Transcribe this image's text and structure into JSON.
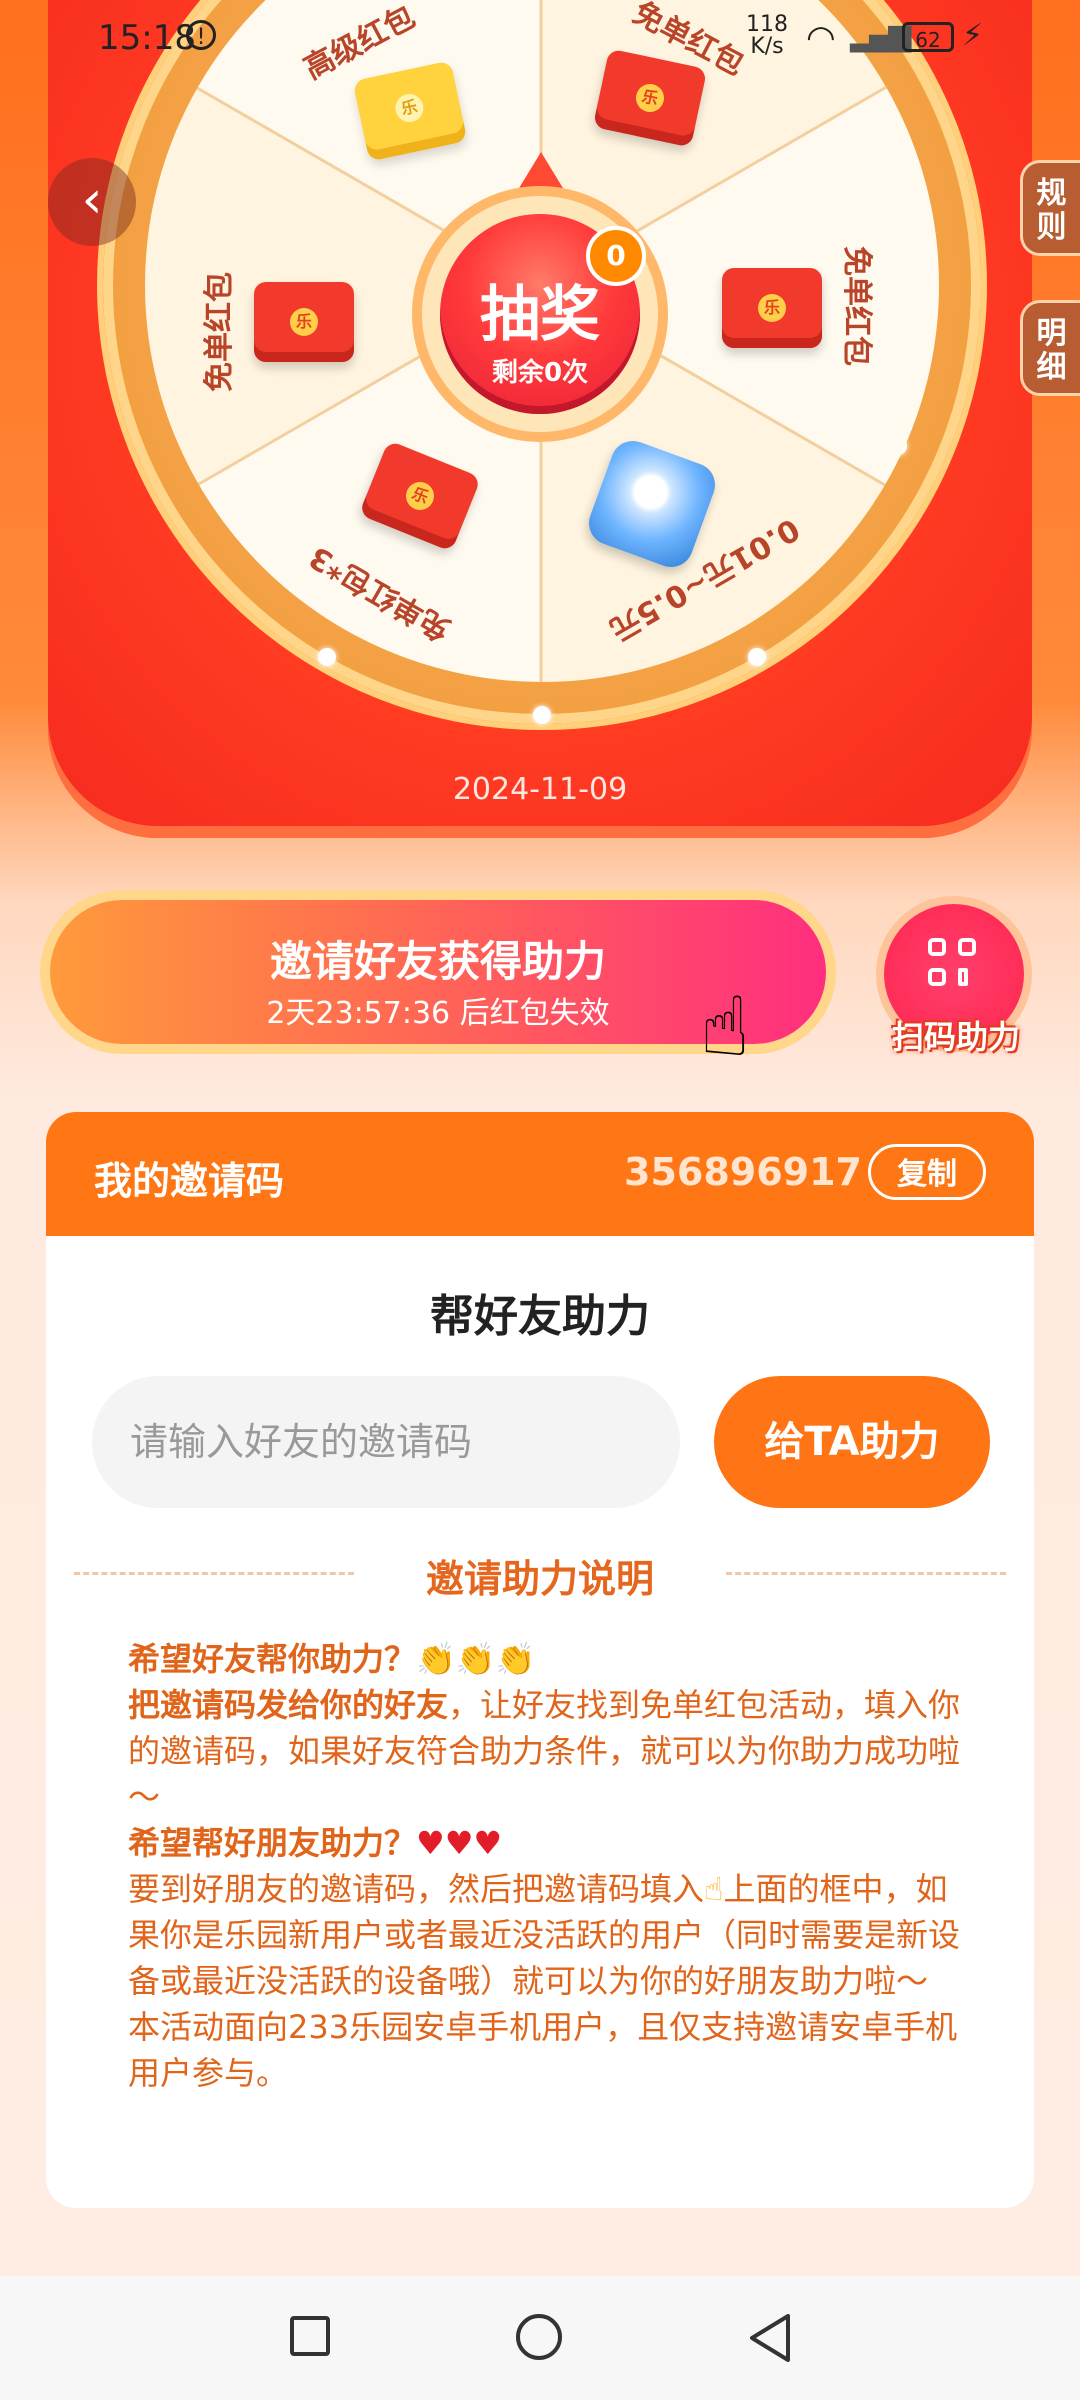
{
  "status_bar": {
    "time": "15:18",
    "alert_icon": "!",
    "net_speed": "118",
    "net_unit": "K/s",
    "battery": "62"
  },
  "wheel": {
    "prizes": [
      {
        "label": "高级红包",
        "icon": "yellow-envelope"
      },
      {
        "label": "免单红包",
        "icon": "red-envelope"
      },
      {
        "label": "免单红包",
        "icon": "red-envelope"
      },
      {
        "label": "0.01元~0.5元",
        "icon": "game-thumbnail"
      },
      {
        "label": "免单红包*3",
        "icon": "red-envelope-stack"
      },
      {
        "label": "免单红包",
        "icon": "red-envelope"
      }
    ],
    "envelope_seal": "乐",
    "spin_label": "抽奖",
    "remaining_label": "剩余0次",
    "badge_count": "0",
    "date": "2024-11-09"
  },
  "side_tabs": {
    "rules": "规则",
    "details": "明细"
  },
  "invite": {
    "button_label": "邀请好友获得助力",
    "countdown_text": "2天23:57:36 后红包失效",
    "scan_label": "扫码助力"
  },
  "panel": {
    "my_code_label": "我的邀请码",
    "my_code": "356896917",
    "copy_label": "复制",
    "help_title": "帮好友助力",
    "input_placeholder": "请输入好友的邀请码",
    "help_button": "给TA助力",
    "desc_title": "邀请助力说明",
    "desc": {
      "p1_title": "希望好友帮你助力？",
      "p1_bold": "把邀请码发给你的好友",
      "p1_text": "，让好友找到免单红包活动，填入你的邀请码，如果好友符合助力条件，就可以为你助力成功啦～",
      "p2_title": "希望帮好朋友助力？",
      "p2_text_a": "要到好朋友的邀请码，然后把邀请码填入",
      "p2_text_b": "上面的框中，如果你是乐园新用户或者最近没活跃的用户（同时需要是新设备或最近没活跃的设备哦）就可以为你的好朋友助力啦～",
      "p3_text": "本活动面向233乐园安卓手机用户，且仅支持邀请安卓手机用户参与。"
    }
  },
  "colors": {
    "accent_orange": "#ff7714",
    "spin_red": "#e81f3a",
    "desc_text": "#e06419"
  }
}
